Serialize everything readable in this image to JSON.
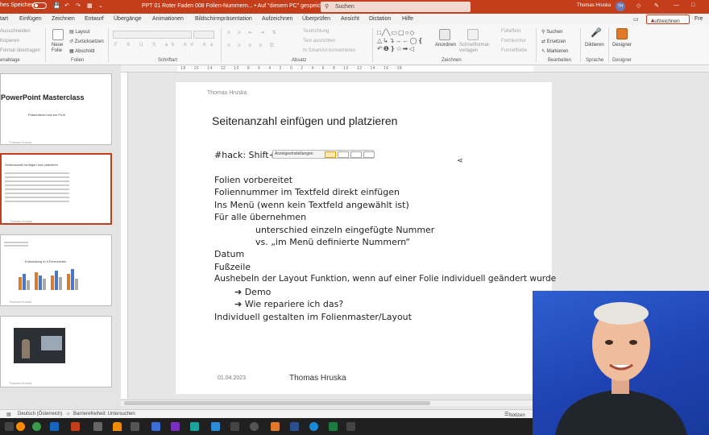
{
  "titlebar": {
    "autosave_label": "hes Speichern",
    "doc_title": "PPT 01 Roter Faden 008 Folien-Nummern... • Auf \"diesem PC\" gespeichert ∨",
    "search_placeholder": "Suchen",
    "user_name": "Thomas Hruska",
    "user_initials": "TH",
    "bg_color": "#c43e1c"
  },
  "tabs": {
    "items": [
      "tart",
      "Einfügen",
      "Zeichnen",
      "Entwurf",
      "Übergänge",
      "Animationen",
      "Bildschirmpräsentation",
      "Aufzeichnen",
      "Überprüfen",
      "Ansicht",
      "Dictation",
      "Hilfe"
    ],
    "record_button": "Aufzeichnen",
    "share_button": "Fre"
  },
  "ribbon": {
    "clipboard": {
      "items": [
        "Ausschneiden",
        "Kopieren",
        "Format übertragen"
      ],
      "group": "enablage"
    },
    "slides": {
      "new_slide": "Neue\nFolie",
      "layout": "Layout",
      "reset": "Zurücksetzen",
      "section": "Abschnitt",
      "group": "Folien"
    },
    "font": {
      "group": "Schriftart"
    },
    "paragraph": {
      "group": "Absatz",
      "items": [
        "Textrichtung",
        "Text ausrichten",
        "In SmartArt konvertieren"
      ]
    },
    "drawing": {
      "arrange": "Anordnen",
      "quick_styles": "Schnellformat-\nvorlagen",
      "group": "Zeichnen",
      "items": [
        "Fülleffekt",
        "Formkontur",
        "Formeffekte"
      ]
    },
    "editing": {
      "find": "Suchen",
      "replace": "Ersetzen",
      "select": "Markieren",
      "group": "Bearbeiten"
    },
    "voice": {
      "dictate": "Diktieren",
      "group": "Sprache"
    },
    "designer": {
      "label": "Designer",
      "group": "Designer"
    }
  },
  "ruler": {
    "marks": "· 18 · · 16 · · 14 · · 12 · · 10 · · 8 · · 6 · · 4 · · 2 · · 0 · · 2 · · 4 · · 6 · · 8 · · 10 · · 12 · · 14 · · 16 · · 18"
  },
  "thumbnails": [
    {
      "title": "PowerPoint Masterclass",
      "subtitle": "Präsentieren wie ein Profi",
      "footer": "Thomas Hruska"
    },
    {
      "title": "Seitenanzahl einfügen und platzieren",
      "footer": "Thomas Hruska"
    },
    {
      "title": "Entwicklung in 3 Kennzahlen",
      "footer": "Thomas Hruska"
    },
    {
      "title": "",
      "footer": "Thomas Hruska"
    }
  ],
  "slide": {
    "header": "Thomas Hruska",
    "title": "Seitenanzahl einfügen und platzieren",
    "hack_prefix": "#hack: Shift+",
    "hack_toolbar_label": "Anzeigeeinstellungen",
    "lines": [
      "Folien vorbereitet",
      "Foliennummer im Textfeld direkt einfügen",
      "Ins Menü (wenn kein Textfeld angewählt ist)",
      "Für alle übernehmen",
      "unterschied  einzeln eingefügte Nummer",
      "vs. „im Menü definierte Nummern“",
      "Datum",
      "Fußzeile",
      "Aushebeln der Layout Funktion, wenn auf einer Folie individuell geändert wurde",
      "➔ Demo",
      "➔ Wie repariere ich das?",
      "Individuell gestalten im Folienmaster/Layout"
    ],
    "footer_date": "01.04.2023",
    "footer_name": "Thomas Hruska"
  },
  "statusbar": {
    "language": "Deutsch (Österreich)",
    "accessibility": "Barrierefreiheit: Untersuchen",
    "notes": "Notizen"
  }
}
